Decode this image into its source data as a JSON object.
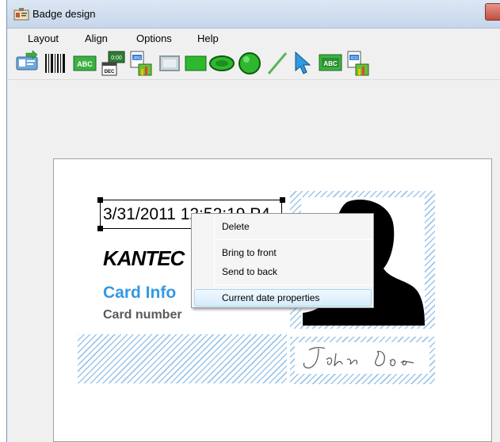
{
  "window": {
    "title": "Badge design"
  },
  "menu": [
    "Layout",
    "Align",
    "Options",
    "Help"
  ],
  "toolbar": [
    {
      "icon": "import-icon"
    },
    {
      "icon": "barcode-icon"
    },
    {
      "icon": "text-abc-icon",
      "label": "ABC"
    },
    {
      "icon": "date-time-icon",
      "label": "0:00",
      "sublabel": "DEC"
    },
    {
      "icon": "image-jpg-icon",
      "label": "JPG"
    },
    {
      "icon": "frame-rectangle-icon"
    },
    {
      "icon": "filled-rectangle-icon"
    },
    {
      "icon": "ellipse-icon"
    },
    {
      "icon": "circle-icon"
    },
    {
      "icon": "line-icon"
    },
    {
      "icon": "pointer-icon"
    },
    {
      "icon": "text-field-abc-icon",
      "label": "ABC"
    },
    {
      "icon": "image-ico-icon",
      "label": "ICO"
    }
  ],
  "badge": {
    "date_text": "3/31/2011 12:52:19 P4",
    "logo_text": "KANTEC",
    "card_info": "Card Info",
    "card_number": "Card number",
    "signature": "John Doe"
  },
  "context_menu": {
    "items": [
      "Delete",
      "Bring to front",
      "Send to back",
      "Current date properties"
    ],
    "highlighted": "Current date properties"
  },
  "colors": {
    "accent": "#3399e6",
    "hatch": "#9cc6ea",
    "highlight": "#d5ecfb"
  }
}
